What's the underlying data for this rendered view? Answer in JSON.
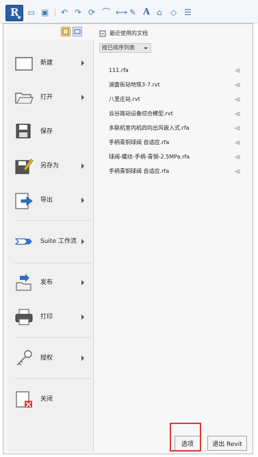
{
  "toolbar": {
    "app_icon": "revit-R-icon",
    "icons": [
      "open-icon",
      "save-icon",
      "undo-icon",
      "redo-icon",
      "sync-icon",
      "measure-icon",
      "dimension-icon",
      "tag-icon",
      "text-icon",
      "3d-view-icon",
      "section-icon",
      "thin-lines-icon"
    ],
    "text_tool_letter": "A"
  },
  "menu": {
    "items": [
      {
        "label": "新建",
        "icon": "new-document-icon",
        "has_submenu": true
      },
      {
        "label": "打开",
        "icon": "open-folder-icon",
        "has_submenu": true
      },
      {
        "label": "保存",
        "icon": "save-icon",
        "has_submenu": false
      },
      {
        "label": "另存为",
        "icon": "save-as-icon",
        "has_submenu": true
      },
      {
        "label": "导出",
        "icon": "export-icon",
        "has_submenu": true
      },
      {
        "label": "Suite 工作流",
        "icon": "suite-workflow-icon",
        "has_submenu": true
      },
      {
        "label": "发布",
        "icon": "publish-icon",
        "has_submenu": true
      },
      {
        "label": "打印",
        "icon": "print-icon",
        "has_submenu": true
      },
      {
        "label": "授权",
        "icon": "license-key-icon",
        "has_submenu": true
      },
      {
        "label": "关闭",
        "icon": "close-document-icon",
        "has_submenu": false
      }
    ]
  },
  "recent": {
    "title": "最近使用的文档",
    "sort_label": "按已排序列表",
    "documents": [
      "111.rfa",
      "湖畲街站地铁3-7.rvt",
      "八里庄站.rvt",
      "云谷路站设备综合模型.rvt",
      "多联机室内机四向出风嵌入式.rfa",
      "手柄青铜球阀 自适应.rfa",
      "球阀-螺纹-手柄-青铜-2.5MPa.rfa",
      "手柄青铜球阀 自适应.rfa"
    ]
  },
  "buttons": {
    "options": "选项",
    "exit": "退出 Revit"
  },
  "colors": {
    "highlight": "#e03535",
    "app_button": "#2a5fa6"
  }
}
